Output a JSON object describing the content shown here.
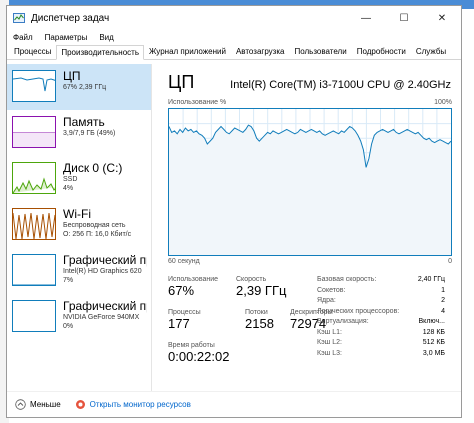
{
  "window": {
    "title": "Диспетчер задач",
    "controls": [
      "—",
      "☐",
      "✕"
    ]
  },
  "menu": [
    "Файл",
    "Параметры",
    "Вид"
  ],
  "tabs": [
    {
      "label": "Процессы",
      "active": false
    },
    {
      "label": "Производительность",
      "active": true
    },
    {
      "label": "Журнал приложений",
      "active": false
    },
    {
      "label": "Автозагрузка",
      "active": false
    },
    {
      "label": "Пользователи",
      "active": false
    },
    {
      "label": "Подробности",
      "active": false
    },
    {
      "label": "Службы",
      "active": false
    }
  ],
  "sidebar": {
    "items": [
      {
        "name": "ЦП",
        "line1": "67%  2,39 ГГц",
        "line2": "",
        "active": true,
        "color": "#117dbb"
      },
      {
        "name": "Память",
        "line1": "3,9/7,9 ГБ (49%)",
        "line2": "",
        "active": false,
        "color": "#8b12ae"
      },
      {
        "name": "Диск 0 (C:)",
        "line1": "SSD",
        "line2": "4%",
        "active": false,
        "color": "#4da60c"
      },
      {
        "name": "Wi-Fi",
        "line1": "Беспроводная сеть",
        "line2": "О: 256 П: 16,0 Кбит/с",
        "active": false,
        "color": "#a74f01"
      },
      {
        "name": "Графический проц",
        "line1": "Intel(R) HD Graphics 620",
        "line2": "7%",
        "active": false,
        "color": "#117dbb"
      },
      {
        "name": "Графический проц",
        "line1": "NVIDIA GeForce 940MX",
        "line2": "0%",
        "active": false,
        "color": "#117dbb"
      }
    ]
  },
  "main": {
    "title": "ЦП",
    "cpu_model": "Intel(R) Core(TM) i3-7100U CPU @ 2.40GHz",
    "graph_label_left": "Использование %",
    "graph_label_right": "100%",
    "graph_bottom_left": "60 секунд",
    "graph_bottom_right": "0",
    "accent_color": "#117dbb",
    "usage_history": [
      88,
      84,
      85,
      83,
      86,
      84,
      87,
      85,
      86,
      84,
      85,
      83,
      82,
      80,
      76,
      78,
      80,
      84,
      86,
      88,
      86,
      84,
      83,
      85,
      87,
      86,
      85,
      84,
      86,
      89,
      88,
      85,
      80,
      78,
      80,
      82,
      84,
      83,
      85,
      84,
      83,
      84,
      85,
      86,
      85,
      84,
      83,
      84,
      86,
      85,
      84,
      85,
      86,
      85,
      84,
      85,
      83,
      82,
      83,
      84,
      85,
      84,
      83,
      85,
      84,
      86,
      88,
      87,
      85,
      82,
      78,
      72,
      60,
      66,
      76,
      82,
      84,
      85,
      86,
      85,
      84,
      85,
      86,
      84,
      83,
      84,
      85,
      86,
      85,
      84,
      83,
      84,
      82,
      80,
      79,
      80,
      78,
      77,
      78,
      79,
      78,
      77,
      76,
      78
    ],
    "stats": {
      "usage_label": "Использование",
      "usage_value": "67%",
      "speed_label": "Скорость",
      "speed_value": "2,39 ГГц",
      "processes_label": "Процессы",
      "processes_value": "177",
      "threads_label": "Потоки",
      "threads_value": "2158",
      "handles_label": "Дескрипторы",
      "handles_value": "72974",
      "uptime_label": "Время работы",
      "uptime_value": "0:00:22:02"
    },
    "details": [
      {
        "label": "Базовая скорость:",
        "value": "2,40 ГГц"
      },
      {
        "label": "Сокетов:",
        "value": "1"
      },
      {
        "label": "Ядра:",
        "value": "2"
      },
      {
        "label": "Логических процессоров:",
        "value": "4"
      },
      {
        "label": "Виртуализация:",
        "value": "Включ..."
      },
      {
        "label": "Кэш L1:",
        "value": "128 КБ"
      },
      {
        "label": "Кэш L2:",
        "value": "512 КБ"
      },
      {
        "label": "Кэш L3:",
        "value": "3,0 МБ"
      }
    ]
  },
  "footer": {
    "less_label": "Меньше",
    "resource_monitor_label": "Открыть монитор ресурсов"
  }
}
